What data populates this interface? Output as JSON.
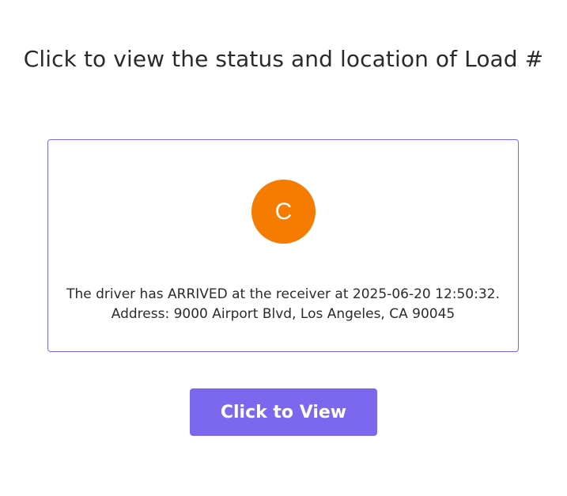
{
  "header": {
    "title": "Click to view the status and location of Load #"
  },
  "card": {
    "avatar_letter": "C",
    "status_line": "The driver has ARRIVED at the receiver at 2025-06-20 12:50:32.",
    "address_line": "Address: 9000 Airport Blvd, Los Angeles, CA 90045"
  },
  "actions": {
    "view_label": "Click to View"
  },
  "colors": {
    "accent": "#7b68ee",
    "avatar_bg": "#f57c00",
    "button_bg": "#7b68ee"
  }
}
